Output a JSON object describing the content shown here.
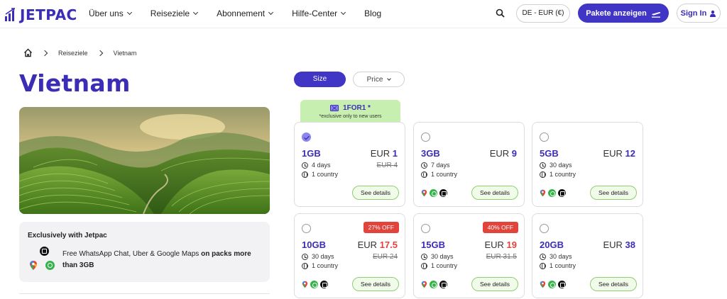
{
  "nav": {
    "brand": "JETPAC",
    "menu": [
      {
        "label": "Über uns",
        "has_dropdown": true
      },
      {
        "label": "Reiseziele",
        "has_dropdown": true
      },
      {
        "label": "Abonnement",
        "has_dropdown": true
      },
      {
        "label": "Hilfe-Center",
        "has_dropdown": true
      },
      {
        "label": "Blog",
        "has_dropdown": false
      }
    ],
    "currency": "DE - EUR (€)",
    "cta_label": "Pakete anzeigen",
    "signin_label": "Sign In"
  },
  "breadcrumb": {
    "items": [
      "Reiseziele",
      "Vietnam"
    ]
  },
  "page": {
    "title": "Vietnam"
  },
  "exclusive": {
    "heading": "Exclusively with Jetpac",
    "text_plain": "Free WhatsApp Chat, Uber & Google Maps ",
    "text_bold": "on packs more than 3GB"
  },
  "sort": {
    "size_label": "Size",
    "price_label": "Price",
    "active": "Size"
  },
  "promo": {
    "code": "1FOR1 *",
    "note": "*exclusive only to new users"
  },
  "plans": [
    {
      "size": "1GB",
      "currency": "EUR",
      "price": "1",
      "old_price": "EUR 4",
      "days": "4 days",
      "countries": "1 country",
      "selected": true,
      "badge": "",
      "details_label": "See details"
    },
    {
      "size": "3GB",
      "currency": "EUR",
      "price": "9",
      "old_price": "",
      "days": "7 days",
      "countries": "1 country",
      "selected": false,
      "badge": "",
      "details_label": "See details"
    },
    {
      "size": "5GB",
      "currency": "EUR",
      "price": "12",
      "old_price": "",
      "days": "30 days",
      "countries": "1 country",
      "selected": false,
      "badge": "",
      "details_label": "See details"
    },
    {
      "size": "10GB",
      "currency": "EUR",
      "price": "17.5",
      "old_price": "EUR 24",
      "days": "30 days",
      "countries": "1 country",
      "selected": false,
      "badge": "27% OFF",
      "details_label": "See details"
    },
    {
      "size": "15GB",
      "currency": "EUR",
      "price": "19",
      "old_price": "EUR 31.5",
      "days": "30 days",
      "countries": "1 country",
      "selected": false,
      "badge": "40% OFF",
      "details_label": "See details"
    },
    {
      "size": "20GB",
      "currency": "EUR",
      "price": "38",
      "old_price": "",
      "days": "30 days",
      "countries": "1 country",
      "selected": false,
      "badge": "",
      "details_label": "See details"
    }
  ],
  "colors": {
    "brand": "#3b2db6",
    "cta": "#4035c4",
    "sale": "#e0443a",
    "promo_bg": "#c7f0b0",
    "details_border": "#8fce6f"
  }
}
